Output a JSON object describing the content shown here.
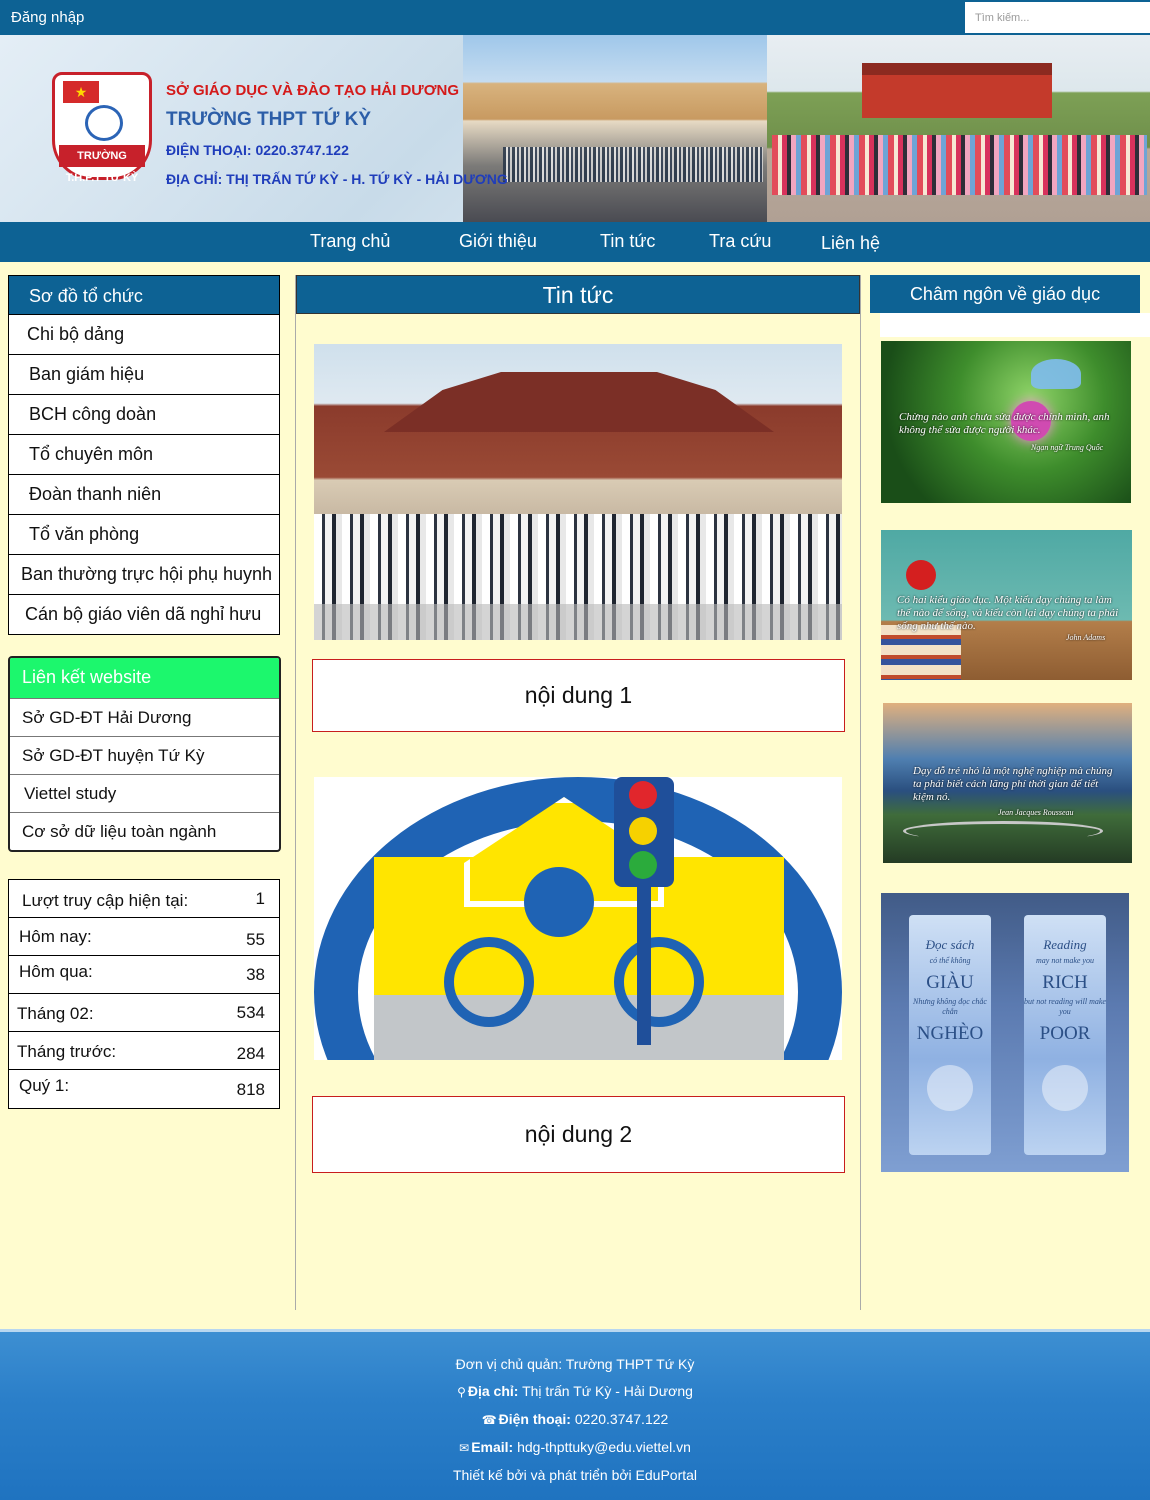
{
  "topbar": {
    "login_label": "Đăng nhập",
    "search_placeholder": "Tìm kiếm..."
  },
  "banner": {
    "line1": "SỞ GIÁO DỤC VÀ ĐÀO TẠO HẢI DƯƠNG",
    "line2": "TRƯỜNG THPT TỨ KỲ",
    "line3": "ĐIỆN THOẠI: 0220.3747.122",
    "line4": "ĐỊA CHỈ: THỊ TRẤN TỨ KỲ - H. TỨ KỲ - HẢI DƯƠNG",
    "logo_text": "TRƯỜNG T.H.P.T TỨ KỲ"
  },
  "nav": {
    "items": [
      "Trang chủ",
      "Giới thiệu",
      "Tin tức",
      "Tra cứu",
      "Liên hệ"
    ]
  },
  "org": {
    "title": "Sơ đồ tổ chức",
    "items": [
      "Chi bộ dảng",
      "Ban giám hiệu",
      "BCH công doàn",
      "Tổ chuyên môn",
      "Đoàn thanh niên",
      "Tổ văn phòng",
      "Ban thường trực hội phụ huynh",
      "Cán bộ giáo viên dã nghỉ hưu"
    ]
  },
  "links": {
    "title": "Liên kết website",
    "items": [
      "Sở GD-ĐT Hải Dương",
      "Sở GD-ĐT huyện Tứ Kỳ",
      "Viettel study",
      "Cơ sở dữ liệu toàn ngành"
    ]
  },
  "stats": [
    {
      "label": "Lượt truy cập hiện tại:",
      "value": "1"
    },
    {
      "label": "Hôm nay:",
      "value": "55"
    },
    {
      "label": "Hôm qua:",
      "value": "38"
    },
    {
      "label": "Tháng 02:",
      "value": "534"
    },
    {
      "label": "Tháng trước:",
      "value": "284"
    },
    {
      "label": "Quý 1:",
      "value": "818"
    }
  ],
  "news": {
    "title": "Tin tức",
    "content1": "nội dung 1",
    "content2": "nội dung 2"
  },
  "quotes": {
    "title": "Châm ngôn về giáo dục",
    "q1": "Chừng nào anh chưa sửa được chính mình, anh không thể sửa được người khác.",
    "q1_author": "Ngạn ngữ Trung Quốc",
    "q2": "Có hai kiểu giáo dục. Một kiểu dạy chúng ta làm thế nào để sống, và kiểu còn lại dạy chúng ta phải sống như thế nào.",
    "q2_author": "John Adams",
    "q3": "Dạy dỗ trẻ nhỏ là một nghệ nghiệp mà chúng ta phải biết cách lãng phí thời gian để tiết kiệm nó.",
    "q3_author": "Jean Jacques Rousseau",
    "bm1_small": "Đọc sách",
    "bm1_tiny1": "có thể không",
    "bm1_big1": "GIÀU",
    "bm1_tiny2": "Nhưng không đọc chắc chắn",
    "bm1_big2": "NGHÈO",
    "bm2_small": "Reading",
    "bm2_tiny1": "may not make you",
    "bm2_big1": "RICH",
    "bm2_tiny2": "but not reading will make you",
    "bm2_big2": "POOR"
  },
  "footer": {
    "owner": "Đơn vị chủ quản: Trường THPT Tứ Kỳ",
    "address_label": "Địa chỉ:",
    "address": "Thị trấn Tứ Kỳ - Hải Dương",
    "phone_label": "Điện thoại:",
    "phone": "0220.3747.122",
    "email_label": "Email:",
    "email": "hdg-thpttuky@edu.viettel.vn",
    "credit": "Thiết kế bởi và phát triển bởi EduPortal"
  },
  "colors": {
    "primary": "#0d6294",
    "page_background": "#fffccf",
    "link_header": "#1cf76d",
    "content_border": "#c71d1d"
  }
}
